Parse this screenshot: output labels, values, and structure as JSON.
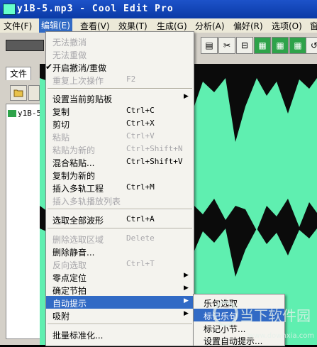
{
  "window": {
    "title": "y1B-5.mp3 - Cool Edit Pro"
  },
  "menubar": {
    "items": [
      "文件(F)",
      "编辑(E)",
      "查看(V)",
      "效果(T)",
      "生成(G)",
      "分析(A)",
      "偏好(R)",
      "选项(O)",
      "窗"
    ],
    "active": "编辑(E)"
  },
  "left_panel": {
    "tab_label": "文件",
    "file_name": "y1B-5"
  },
  "edit_menu": {
    "items": [
      {
        "label": "无法撤消",
        "shortcut": "",
        "disabled": true
      },
      {
        "label": "无法重做",
        "shortcut": "",
        "disabled": true
      },
      {
        "label": "开启撤消/重做",
        "shortcut": "",
        "checked": true
      },
      {
        "label": "重复上次操作",
        "shortcut": "F2",
        "disabled": true
      },
      {
        "label": "设置当前剪贴板",
        "shortcut": "",
        "submenu": true
      },
      {
        "label": "复制",
        "shortcut": "Ctrl+C"
      },
      {
        "label": "剪切",
        "shortcut": "Ctrl+X"
      },
      {
        "label": "粘贴",
        "shortcut": "Ctrl+V",
        "disabled": true
      },
      {
        "label": "粘贴为新的",
        "shortcut": "Ctrl+Shift+N",
        "disabled": true
      },
      {
        "label": "混合粘贴...",
        "shortcut": "Ctrl+Shift+V"
      },
      {
        "label": "复制为新的",
        "shortcut": ""
      },
      {
        "label": "插入多轨工程",
        "shortcut": "Ctrl+M"
      },
      {
        "label": "插入多轨播放列表",
        "shortcut": "",
        "disabled": true
      },
      {
        "label": "选取全部波形",
        "shortcut": "Ctrl+A"
      },
      {
        "label": "删除选取区域",
        "shortcut": "Delete",
        "disabled": true
      },
      {
        "label": "删除静音...",
        "shortcut": ""
      },
      {
        "label": "反向选取",
        "shortcut": "Ctrl+T",
        "disabled": true
      },
      {
        "label": "零点定位",
        "shortcut": "",
        "submenu": true
      },
      {
        "label": "确定节拍",
        "shortcut": "",
        "submenu": true
      },
      {
        "label": "自动提示",
        "shortcut": "",
        "submenu": true,
        "highlighted": true
      },
      {
        "label": "吸附",
        "shortcut": "",
        "submenu": true
      },
      {
        "label": "批量标准化...",
        "shortcut": ""
      }
    ]
  },
  "submenu": {
    "items": [
      {
        "label": "乐句选取"
      },
      {
        "label": "标记乐句",
        "highlighted": true
      },
      {
        "label": "标记小节..."
      },
      {
        "label": "设置自动提示..."
      }
    ]
  },
  "watermark": {
    "text": "当下软件园",
    "url": "www.downxia.com"
  },
  "colors": {
    "waveform": "#5fefb0",
    "highlight": "#316ac5",
    "titlebar": "#0a3aa6"
  },
  "icons": [
    "app-icon",
    "open-folder-icon",
    "tool-icon",
    "check-icon",
    "submenu-arrow-icon"
  ]
}
